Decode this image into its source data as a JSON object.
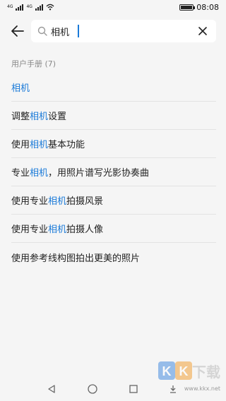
{
  "status_bar": {
    "time": "08:08",
    "sim1": "4G",
    "sim2": "4G"
  },
  "search": {
    "query": "相机",
    "placeholder": ""
  },
  "results": {
    "section_title": "用户手册 (7)",
    "items": [
      [
        {
          "text": "相机",
          "hl": true
        }
      ],
      [
        {
          "text": "调整",
          "hl": false
        },
        {
          "text": "相机",
          "hl": true
        },
        {
          "text": "设置",
          "hl": false
        }
      ],
      [
        {
          "text": "使用",
          "hl": false
        },
        {
          "text": "相机",
          "hl": true
        },
        {
          "text": "基本功能",
          "hl": false
        }
      ],
      [
        {
          "text": "专业",
          "hl": false
        },
        {
          "text": "相机",
          "hl": true
        },
        {
          "text": "，用照片谱写光影协奏曲",
          "hl": false
        }
      ],
      [
        {
          "text": "使用专业",
          "hl": false
        },
        {
          "text": "相机",
          "hl": true
        },
        {
          "text": "拍摄风景",
          "hl": false
        }
      ],
      [
        {
          "text": "使用专业",
          "hl": false
        },
        {
          "text": "相机",
          "hl": true
        },
        {
          "text": "拍摄人像",
          "hl": false
        }
      ],
      [
        {
          "text": "使用参考线构图拍出更美的照片",
          "hl": false
        }
      ]
    ]
  },
  "watermark": {
    "logo": "KK下载",
    "site": "www.kkx.net"
  },
  "colors": {
    "accent": "#1a7ad8",
    "background": "#f5f5f5"
  }
}
